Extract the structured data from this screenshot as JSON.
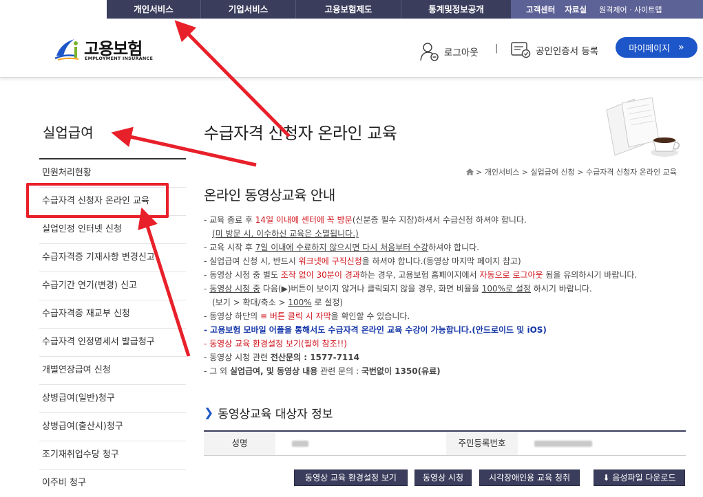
{
  "topnav": {
    "main": [
      "개인서비스",
      "기업서비스",
      "고용보험제도",
      "통계및정보공개"
    ],
    "util": [
      "고객센터",
      "자료실",
      "원격제어 · 사이트맵"
    ]
  },
  "header": {
    "logo_name": "고용보험",
    "logo_sub": "EMPLOYMENT INSURANCE",
    "logout": "로그아웃",
    "separator": "|",
    "cert": "공인인증서 등록",
    "mypage": "마이페이지",
    "mypage_arrow": "»"
  },
  "sidebar": {
    "title": "실업급여",
    "items": [
      "민원처리현황",
      "수급자격 신청자 온라인 교육",
      "실업인정 인터넷 신청",
      "수급자격증 기재사항 변경신고",
      "수급기간 연기(변경) 신고",
      "수급자격증 재교부 신청",
      "수급자격 인정명세서 발급청구",
      "개별연장급여 신청",
      "상병급여(일반)청구",
      "상병급여(출산시)청구",
      "조기재취업수당 청구",
      "이주비 청구"
    ]
  },
  "main": {
    "page_title": "수급자격 신청자 온라인 교육",
    "breadcrumb": "> 개인서비스 > 실업급여 신청 > 수급자격 신청자 온라인 교육",
    "section_title": "온라인 동영상교육 안내",
    "notices": {
      "l1a": "- 교육 종료 후 ",
      "l1b": "14일 이내에 센터에 꼭 방문",
      "l1c": "(신분증 필수 지참)하셔서 수급신청 하셔야 합니다.",
      "l2": "(미 방문 시, 이수하신 교육은 소멸됩니다.)",
      "l3a": "- 교육 시작 후 ",
      "l3b": "7일 이내에 수료하지 않으시면 다시 처음부터 수강",
      "l3c": "하셔야 합니다.",
      "l4a": "- 실업급여 신청 시, 반드시 ",
      "l4b": "워크넷에 구직신청",
      "l4c": "을 하셔야 합니다.(동영상 마지막 페이지 참고)",
      "l5a": "- 동영상 시청 중 별도 ",
      "l5b": "조작 없이 30분이 경과",
      "l5c": "하는 경우, 고용보험 홈페이지에서 ",
      "l5d": "자동으로 로그아웃",
      "l5e": " 됨을 유의하시기 바랍니다.",
      "l6a": "- ",
      "l6b": "동영상 시청 중",
      "l6c": " 다음(▶)버튼이 보이지 않거나 클릭되지 않을 경우, 화면 비율을 ",
      "l6d": "100%로 설정",
      "l6e": " 하시기 바랍니다.",
      "l7a": "(보기 > 확대/축소 > ",
      "l7b": "100%",
      "l7c": " 로 설정)",
      "l8a": "- 동영상 하단의 ",
      "l8b": "≡ 버튼 클릭 시 자막",
      "l8c": "을 확인할 수 있습니다.",
      "l9": "- 고용보험 모바일 어플을 통해서도 수급자격 온라인 교육 수강이 가능합니다.(안드로이드 및 iOS)",
      "l10": "- 동영상 교육 환경설정 보기(필히 참조!!)",
      "l11a": "- 동영상 시청 관련 ",
      "l11b": "전산문의 : 1577-7114",
      "l12a": "- 그 외 ",
      "l12b": "실업급여, 및 동영상 내용",
      "l12c": " 관련 문의 : ",
      "l12d": "국번없이 1350(유료)"
    },
    "info_title": "동영상교육 대상자 정보",
    "info_chev": "❯",
    "info": {
      "name_label": "성명",
      "id_label": "주민등록번호"
    },
    "buttons": [
      "동영상 교육 환경설정 보기",
      "동영상 시청",
      "시각장애인용 교육 청취",
      "음성파일 다운로드"
    ],
    "download_icon": "⬇"
  },
  "colors": {
    "nav_main": "#3a3d5c",
    "nav_util": "#5d6296",
    "accent_blue": "#1d56c8",
    "annotation_red": "#e8202a"
  }
}
